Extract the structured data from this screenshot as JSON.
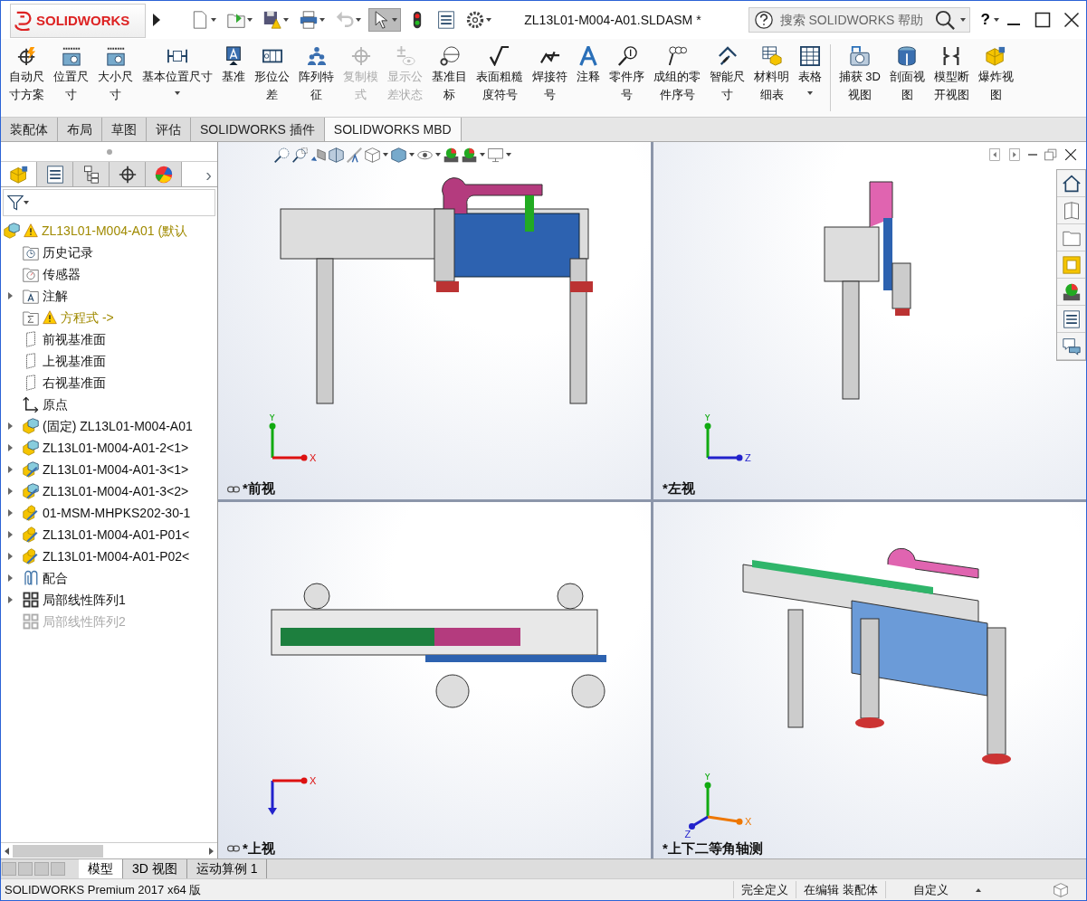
{
  "title_bar": {
    "logo": "SOLIDWORKS",
    "document_title": "ZL13L01-M004-A01.SLDASM *",
    "search": {
      "placeholder": "搜索 SOLIDWORKS 帮助"
    },
    "help": "?"
  },
  "quick_toolbar": [
    {
      "dropdown": true,
      "disabled": false,
      "selected": false
    },
    {
      "dropdown": true,
      "disabled": false,
      "selected": false
    },
    {
      "dropdown": true,
      "disabled": false,
      "selected": false
    },
    {
      "dropdown": true,
      "disabled": false,
      "selected": false
    },
    {
      "dropdown": true,
      "disabled": true,
      "selected": false
    },
    {
      "dropdown": true,
      "disabled": false,
      "selected": true
    },
    {
      "dropdown": false,
      "disabled": false,
      "selected": false
    },
    {
      "dropdown": false,
      "disabled": false,
      "selected": false
    },
    {
      "dropdown": true,
      "disabled": false,
      "selected": false
    }
  ],
  "commands": [
    {
      "label": "自动尺寸方案",
      "disabled": false,
      "dropdown": false
    },
    {
      "label": "位置尺寸",
      "disabled": false,
      "dropdown": false
    },
    {
      "label": "大小尺寸",
      "disabled": false,
      "dropdown": false
    },
    {
      "label": "基本位置尺寸",
      "disabled": false,
      "dropdown": true
    },
    {
      "label": "基准",
      "disabled": false,
      "dropdown": false
    },
    {
      "label": "形位公差",
      "disabled": false,
      "dropdown": false
    },
    {
      "label": "阵列特征",
      "disabled": false,
      "dropdown": false
    },
    {
      "label": "复制模式",
      "disabled": true,
      "dropdown": false
    },
    {
      "label": "显示公差状态",
      "disabled": true,
      "dropdown": false
    },
    {
      "label": "基准目标",
      "disabled": false,
      "dropdown": false
    },
    {
      "label": "表面粗糙度符号",
      "disabled": false,
      "dropdown": false
    },
    {
      "label": "焊接符号",
      "disabled": false,
      "dropdown": false
    },
    {
      "label": "注释",
      "disabled": false,
      "dropdown": false
    },
    {
      "label": "零件序号",
      "disabled": false,
      "dropdown": false
    },
    {
      "label": "成组的零件序号",
      "disabled": false,
      "dropdown": false
    },
    {
      "label": "智能尺寸",
      "disabled": false,
      "dropdown": false
    },
    {
      "label": "材料明细表",
      "disabled": false,
      "dropdown": false
    },
    {
      "label": "表格",
      "disabled": false,
      "dropdown": true
    },
    {
      "label": "捕获 3D视图",
      "disabled": false,
      "dropdown": false
    },
    {
      "label": "剖面视图",
      "disabled": false,
      "dropdown": false
    },
    {
      "label": "模型断开视图",
      "disabled": false,
      "dropdown": false
    },
    {
      "label": "爆炸视图",
      "disabled": false,
      "dropdown": false
    }
  ],
  "command_tabs": [
    {
      "label": "装配体",
      "selected": false
    },
    {
      "label": "布局",
      "selected": false
    },
    {
      "label": "草图",
      "selected": false
    },
    {
      "label": "评估",
      "selected": false
    },
    {
      "label": "SOLIDWORKS 插件",
      "selected": false
    },
    {
      "label": "SOLIDWORKS MBD",
      "selected": true
    }
  ],
  "panel_tabs": [
    {
      "selected": true
    },
    {
      "selected": false
    },
    {
      "selected": false
    },
    {
      "selected": false
    },
    {
      "selected": false
    }
  ],
  "panel_more": "›",
  "tree": [
    {
      "text": "ZL13L01-M004-A01  (默认",
      "expander": false,
      "warning": true,
      "suppressed": false,
      "children": [
        {
          "text": "历史记录",
          "expander": false,
          "warning": false,
          "suppressed": false
        },
        {
          "text": "传感器",
          "expander": false,
          "warning": false,
          "suppressed": false
        },
        {
          "text": "注解",
          "expander": true,
          "warning": false,
          "suppressed": false
        },
        {
          "text": "方程式 ->",
          "expander": false,
          "warning": true,
          "suppressed": false
        },
        {
          "text": "前视基准面",
          "expander": false,
          "warning": false,
          "suppressed": false
        },
        {
          "text": "上视基准面",
          "expander": false,
          "warning": false,
          "suppressed": false
        },
        {
          "text": "右视基准面",
          "expander": false,
          "warning": false,
          "suppressed": false
        },
        {
          "text": "原点",
          "expander": false,
          "warning": false,
          "suppressed": false
        },
        {
          "text": "(固定) ZL13L01-M004-A01",
          "expander": true,
          "warning": false,
          "suppressed": false
        },
        {
          "text": "ZL13L01-M004-A01-2<1>",
          "expander": true,
          "warning": false,
          "suppressed": false
        },
        {
          "text": "ZL13L01-M004-A01-3<1>",
          "expander": true,
          "warning": false,
          "suppressed": false
        },
        {
          "text": "ZL13L01-M004-A01-3<2>",
          "expander": true,
          "warning": false,
          "suppressed": false
        },
        {
          "text": "01-MSM-MHPKS202-30-1",
          "expander": true,
          "warning": false,
          "suppressed": false
        },
        {
          "text": "ZL13L01-M004-A01-P01<",
          "expander": true,
          "warning": false,
          "suppressed": false
        },
        {
          "text": "ZL13L01-M004-A01-P02<",
          "expander": true,
          "warning": false,
          "suppressed": false
        },
        {
          "text": "配合",
          "expander": true,
          "warning": false,
          "suppressed": false
        },
        {
          "text": "局部线性阵列1",
          "expander": true,
          "warning": false,
          "suppressed": false
        },
        {
          "text": "局部线性阵列2",
          "expander": false,
          "warning": false,
          "suppressed": true
        }
      ]
    }
  ],
  "viewports": [
    {
      "label": "*前视",
      "triad": [
        "Y",
        "X"
      ]
    },
    {
      "label": "*左视",
      "triad": [
        "Y",
        "Z"
      ]
    },
    {
      "label": "*上视",
      "triad": [
        "X"
      ]
    },
    {
      "label": "*上下二等角轴测",
      "triad": [
        "Y",
        "X",
        "Z"
      ]
    }
  ],
  "model_tabs": [
    {
      "label": "模型",
      "selected": true
    },
    {
      "label": "3D 视图",
      "selected": false
    },
    {
      "label": "运动算例 1",
      "selected": false
    }
  ],
  "status_bar": {
    "product": "SOLIDWORKS Premium 2017 x64 版",
    "fields": [
      "完全定义",
      "在编辑 装配体",
      "自定义"
    ]
  }
}
